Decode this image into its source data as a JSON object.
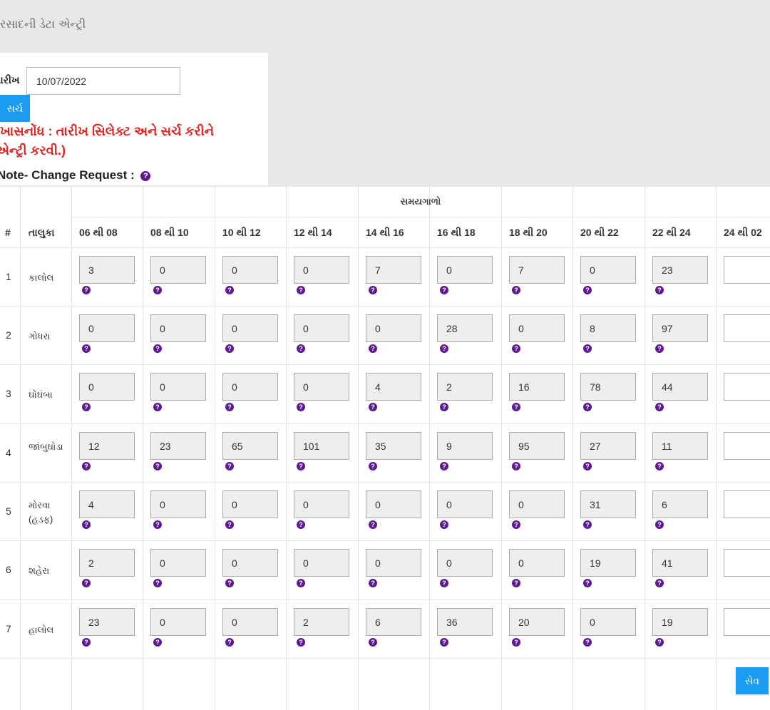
{
  "header": {
    "title": "વરસાદની ડેટા એન્ટ્રી"
  },
  "form": {
    "date_label": "તારીખ",
    "date_value": "10/07/2022",
    "search_label": "સર્ચ",
    "special_note": "(ખાસનોંધ : તારીખ સિલેક્ટ અને સર્ચ કરીને એન્ટ્રી કરવી.)",
    "change_request_label": "Note- Change Request :",
    "help_glyph": "?"
  },
  "table": {
    "group_header": "સમયગાળો",
    "columns": {
      "index": "#",
      "taluka": "તાલુકા"
    },
    "slots": [
      "06 થી 08",
      "08 થી 10",
      "10 થી 12",
      "12 થી 14",
      "14 થી 16",
      "16 થી 18",
      "18 થી 20",
      "20 થી 22",
      "22 થી 24",
      "24 થી 02"
    ],
    "rows": [
      {
        "index": "1",
        "taluka": "કાલોલ",
        "values": [
          "3",
          "0",
          "0",
          "0",
          "7",
          "0",
          "7",
          "0",
          "23",
          ""
        ]
      },
      {
        "index": "2",
        "taluka": "ગોધરા",
        "values": [
          "0",
          "0",
          "0",
          "0",
          "0",
          "28",
          "0",
          "8",
          "97",
          ""
        ]
      },
      {
        "index": "3",
        "taluka": "ઘોઘંબા",
        "values": [
          "0",
          "0",
          "0",
          "0",
          "4",
          "2",
          "16",
          "78",
          "44",
          ""
        ]
      },
      {
        "index": "4",
        "taluka": "જાંબુઘોડા",
        "values": [
          "12",
          "23",
          "65",
          "101",
          "35",
          "9",
          "95",
          "27",
          "11",
          ""
        ]
      },
      {
        "index": "5",
        "taluka": "મોરવા (હડફ)",
        "values": [
          "4",
          "0",
          "0",
          "0",
          "0",
          "0",
          "0",
          "31",
          "6",
          ""
        ]
      },
      {
        "index": "6",
        "taluka": "શહેરા",
        "values": [
          "2",
          "0",
          "0",
          "0",
          "0",
          "0",
          "0",
          "19",
          "41",
          ""
        ]
      },
      {
        "index": "7",
        "taluka": "હાલોલ",
        "values": [
          "23",
          "0",
          "0",
          "2",
          "6",
          "36",
          "20",
          "0",
          "19",
          ""
        ]
      }
    ]
  },
  "actions": {
    "save_label": "સેવ"
  }
}
